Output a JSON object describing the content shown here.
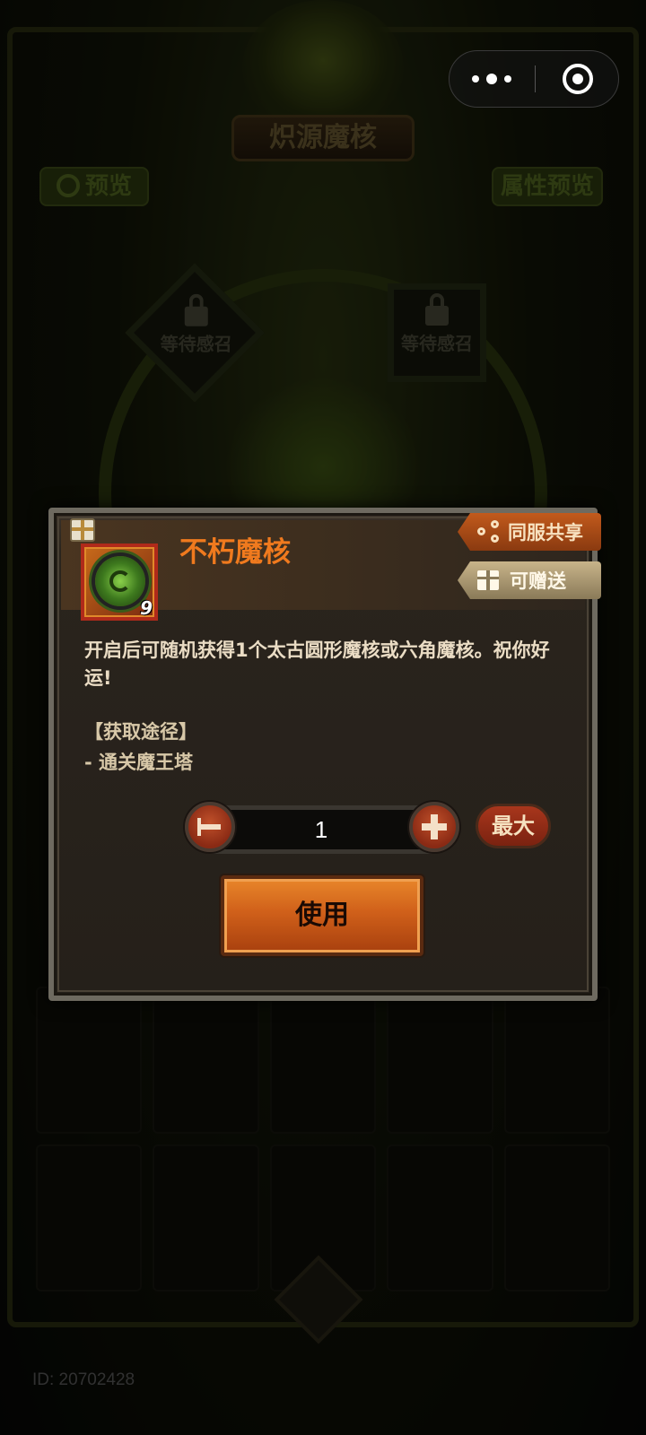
{
  "background": {
    "title": "炽源魔核",
    "preview_label": "预览",
    "attr_preview_label": "属性预览",
    "slot_label_left": "等待感召",
    "slot_label_right": "等待感召",
    "user_id": "ID: 20702428"
  },
  "item_dialog": {
    "item_name": "不朽魔核",
    "item_count": "9",
    "share_label": "同服共享",
    "gift_label": "可赠送",
    "description": "开启后可随机获得1个太古圆形魔核或六角魔核。祝你好运!",
    "source_title": "【获取途径】",
    "source_item": "- 通关魔王塔",
    "quantity": "1",
    "max_label": "最大",
    "use_label": "使用"
  },
  "colors": {
    "item_name": "#f07a1e",
    "use_button": "#d0601a",
    "dialog_bg": "#25201a"
  },
  "icons": {
    "capsule_more": "more-dots-icon",
    "capsule_close": "target-close-icon",
    "share": "share-icon",
    "gift": "gift-icon",
    "minus": "minus-icon",
    "plus": "plus-icon",
    "lock": "lock-icon",
    "search": "search-icon"
  }
}
